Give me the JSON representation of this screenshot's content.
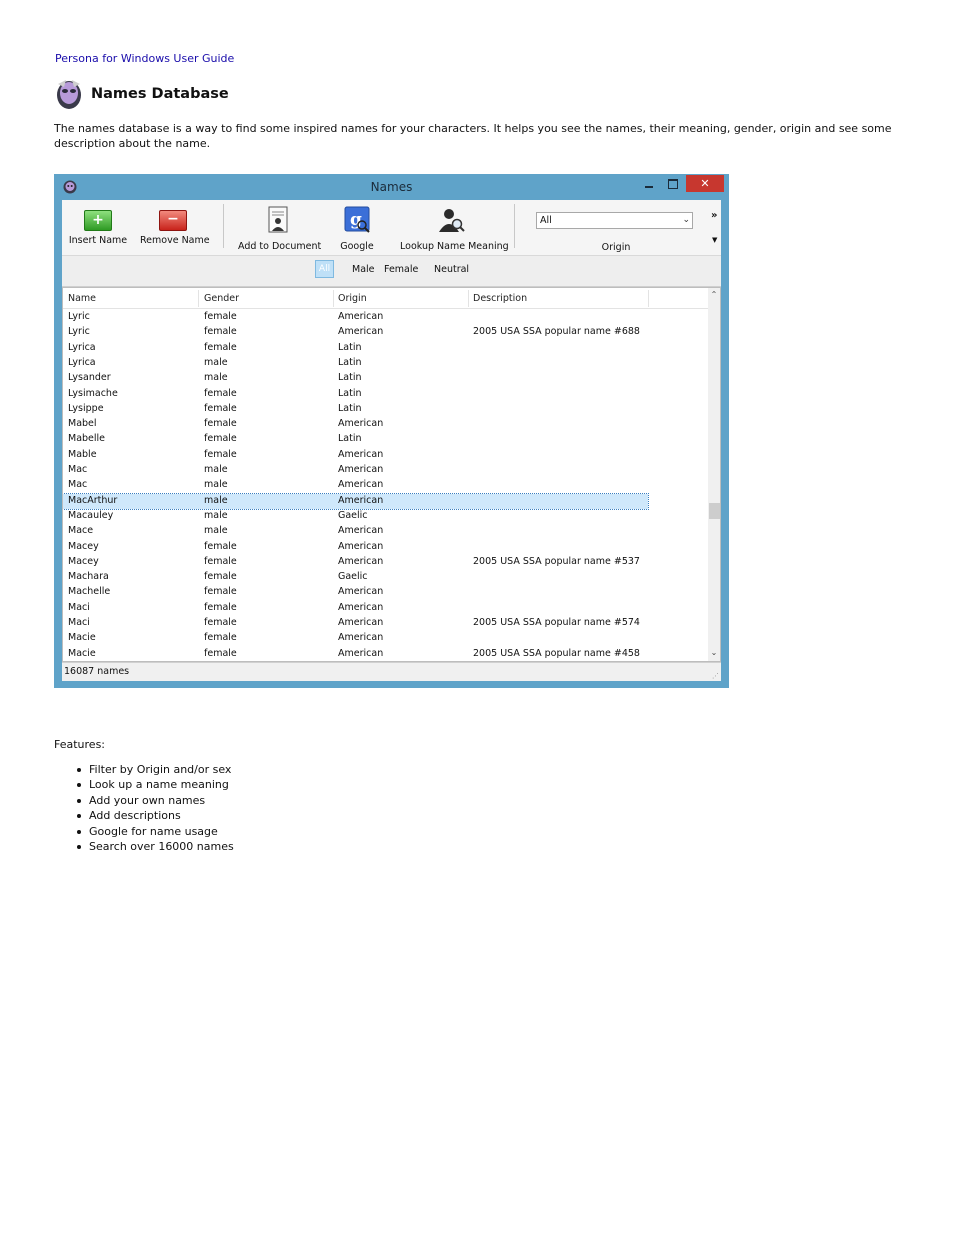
{
  "doc": {
    "breadcrumb": "Persona for Windows User Guide",
    "title": "Names Database",
    "intro": "The names database is a way to find some inspired names for your characters. It helps you see the names, their meaning, gender, origin and see some description about the name."
  },
  "window": {
    "title": "Names",
    "close_glyph": "✕",
    "toolbar": {
      "insert_label": "Insert Name",
      "remove_label": "Remove Name",
      "add_doc_label": "Add to Document",
      "google_label": "Google",
      "lookup_label": "Lookup Name Meaning",
      "origin_value": "All",
      "origin_label": "Origin",
      "overflow_glyph": "»",
      "overflow_dd_glyph": "▼"
    },
    "filters": {
      "all": "All",
      "male": "Male",
      "female": "Female",
      "neutral": "Neutral"
    },
    "columns": {
      "name": "Name",
      "gender": "Gender",
      "origin": "Origin",
      "description": "Description"
    },
    "rows": [
      [
        "Lyric",
        "female",
        "American",
        ""
      ],
      [
        "Lyric",
        "female",
        "American",
        "2005 USA SSA popular name #688"
      ],
      [
        "Lyrica",
        "female",
        "Latin",
        ""
      ],
      [
        "Lyrica",
        "male",
        "Latin",
        ""
      ],
      [
        "Lysander",
        "male",
        "Latin",
        ""
      ],
      [
        "Lysimache",
        "female",
        "Latin",
        ""
      ],
      [
        "Lysippe",
        "female",
        "Latin",
        ""
      ],
      [
        "Mabel",
        "female",
        "American",
        ""
      ],
      [
        "Mabelle",
        "female",
        "Latin",
        ""
      ],
      [
        "Mable",
        "female",
        "American",
        ""
      ],
      [
        "Mac",
        "male",
        "American",
        ""
      ],
      [
        "Mac",
        "male",
        "American",
        ""
      ],
      [
        "MacArthur",
        "male",
        "American",
        ""
      ],
      [
        "Macauley",
        "male",
        "Gaelic",
        ""
      ],
      [
        "Mace",
        "male",
        "American",
        ""
      ],
      [
        "Macey",
        "female",
        "American",
        ""
      ],
      [
        "Macey",
        "female",
        "American",
        "2005 USA SSA popular name #537"
      ],
      [
        "Machara",
        "female",
        "Gaelic",
        ""
      ],
      [
        "Machelle",
        "female",
        "American",
        ""
      ],
      [
        "Maci",
        "female",
        "American",
        ""
      ],
      [
        "Maci",
        "female",
        "American",
        "2005 USA SSA popular name #574"
      ],
      [
        "Macie",
        "female",
        "American",
        ""
      ],
      [
        "Macie",
        "female",
        "American",
        "2005 USA SSA popular name #458"
      ]
    ],
    "selected_row": 12,
    "status": "16087 names"
  },
  "features": {
    "heading": "Features:",
    "items": [
      "Filter by Origin and/or sex",
      "Look up a name meaning",
      "Add your own names",
      "Add descriptions",
      "Google for name usage",
      "Search over 16000 names"
    ]
  }
}
